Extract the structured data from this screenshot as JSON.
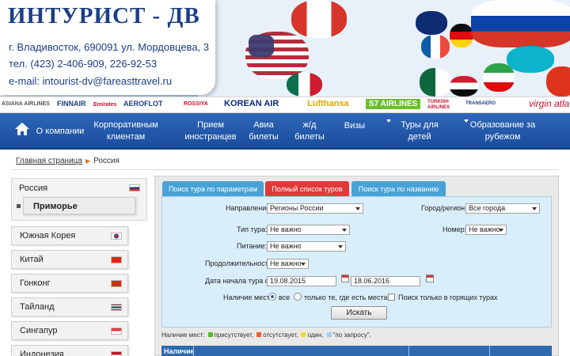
{
  "header": {
    "brand": "ИНТУРИСТ - ДВ",
    "address": "г. Владивосток, 690091 ул. Мордовцева, 3",
    "phone": "тел. (423) 2-406-909, 226-92-53",
    "email": "e-mail: intourist-dv@fareasttravel.ru"
  },
  "airlines": [
    {
      "label": "ASIANA AIRLINES",
      "color": "#555555"
    },
    {
      "label": "FINNAIR",
      "color": "#1a3f86"
    },
    {
      "label": "Emirates",
      "color": "#c8102e"
    },
    {
      "label": "AEROFLOT",
      "color": "#1a3f86"
    },
    {
      "label": "ROSSIYA",
      "color": "#c8102e"
    },
    {
      "label": "KOREAN AIR",
      "color": "#0a2a7a"
    },
    {
      "label": "Lufthansa",
      "color": "#e0a800"
    },
    {
      "label": "S7 AIRLINES",
      "color": "#6bbf2a"
    },
    {
      "label": "TURKISH AIRLINES",
      "color": "#c8102e"
    },
    {
      "label": "TRANSAERO",
      "color": "#1a3f86"
    },
    {
      "label": "virgin atla",
      "color": "#c8102e"
    }
  ],
  "nav": {
    "items": [
      {
        "label": "О компании"
      },
      {
        "label": "Корпоративным клиентам"
      },
      {
        "label": "Прием иностранцев"
      },
      {
        "label": "Авиа билеты"
      },
      {
        "label": "ж/д билеты"
      },
      {
        "label": "Визы"
      },
      {
        "label": "Туры для детей"
      },
      {
        "label": "Образование за рубежом"
      }
    ]
  },
  "breadcrumb": {
    "home": "Главная страница",
    "current": "Россия"
  },
  "sidebar": {
    "active": {
      "label": "Россия",
      "sub": "Приморье"
    },
    "items": [
      {
        "label": "Южная Корея",
        "flag": "korea"
      },
      {
        "label": "Китай",
        "flag": "china"
      },
      {
        "label": "Гонконг",
        "flag": "hongkong"
      },
      {
        "label": "Тайланд",
        "flag": "thailand"
      },
      {
        "label": "Сингапур",
        "flag": "singapore"
      },
      {
        "label": "Индонезия",
        "flag": "indonesia"
      }
    ]
  },
  "tabs": [
    {
      "label": "Поиск тура по параметрам",
      "color": "#47a3d6"
    },
    {
      "label": "Полный список туров",
      "color": "#e23a3a"
    },
    {
      "label": "Поиск тура по названию",
      "color": "#47a3d6"
    }
  ],
  "form": {
    "direction_label": "Направление:",
    "direction_value": "Регионы России",
    "city_label": "Город/регион:",
    "city_value": "Все города",
    "tour_type_label": "Тип тура:",
    "tour_type_value": "Не важно",
    "room_label": "Номер:",
    "room_value": "Не важно",
    "meal_label": "Питание:",
    "meal_value": "Не важно",
    "duration_label": "Продолжительность:",
    "duration_value": "Не важно",
    "date_label": "Дата начала тура с:",
    "date_from": "19.08.2015",
    "date_to": "18.06.2016",
    "availability_label": "Наличие мест:",
    "opt_all": "все",
    "opt_only": "только те, где есть места",
    "hot_label": "Поиск только в горящих турах",
    "search_button": "Искать"
  },
  "legend": {
    "title": "Наличие мест:",
    "items": [
      {
        "label": "присутствует,",
        "color": "#5cb82c"
      },
      {
        "label": "отсутствует,",
        "color": "#e8603a"
      },
      {
        "label": "один,",
        "color": "#f2d83a"
      },
      {
        "label": "\"по запросу\".",
        "color": "#9fd0ec"
      }
    ]
  },
  "table": {
    "first_header": "Наличие"
  }
}
